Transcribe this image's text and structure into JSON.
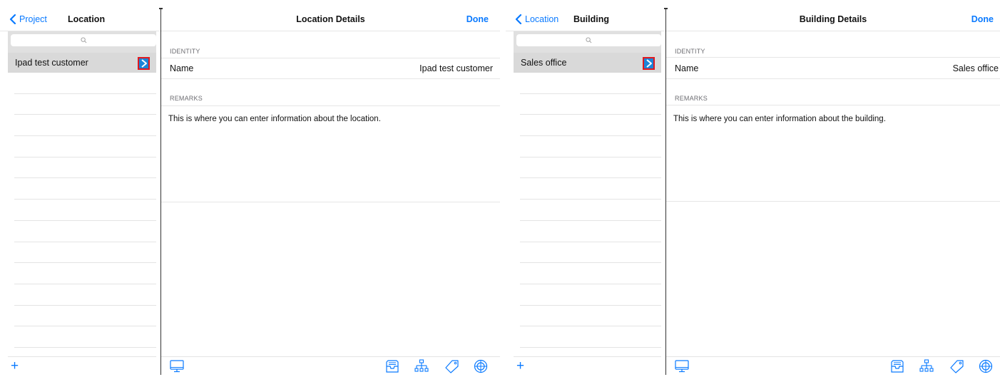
{
  "colors": {
    "accent": "#0a7aff",
    "selected_row": "#d9d9d9",
    "highlight_box": "#e0191f"
  },
  "screens": [
    {
      "master": {
        "back_label": "Project",
        "title": "Location",
        "search_placeholder": "",
        "items": [
          {
            "label": "Ipad test customer",
            "selected": true
          }
        ],
        "add_icon": "plus-icon"
      },
      "detail": {
        "title": "Location Details",
        "done_label": "Done",
        "identity_header": "IDENTITY",
        "name_label": "Name",
        "name_value": "Ipad test customer",
        "remarks_header": "REMARKS",
        "remarks_text": "This is where you can enter information about the location.",
        "toolbar_icons": [
          "monitor-icon",
          "inbox-icon",
          "hierarchy-icon",
          "tag-icon",
          "target-icon"
        ]
      }
    },
    {
      "master": {
        "back_label": "Location",
        "title": "Building",
        "search_placeholder": "",
        "items": [
          {
            "label": "Sales office",
            "selected": true
          }
        ],
        "add_icon": "plus-icon"
      },
      "detail": {
        "title": "Building Details",
        "done_label": "Done",
        "identity_header": "IDENTITY",
        "name_label": "Name",
        "name_value": "Sales office",
        "remarks_header": "REMARKS",
        "remarks_text": "This is where you can enter information about the building.",
        "toolbar_icons": [
          "monitor-icon",
          "inbox-icon",
          "hierarchy-icon",
          "tag-icon",
          "target-icon"
        ]
      }
    }
  ]
}
